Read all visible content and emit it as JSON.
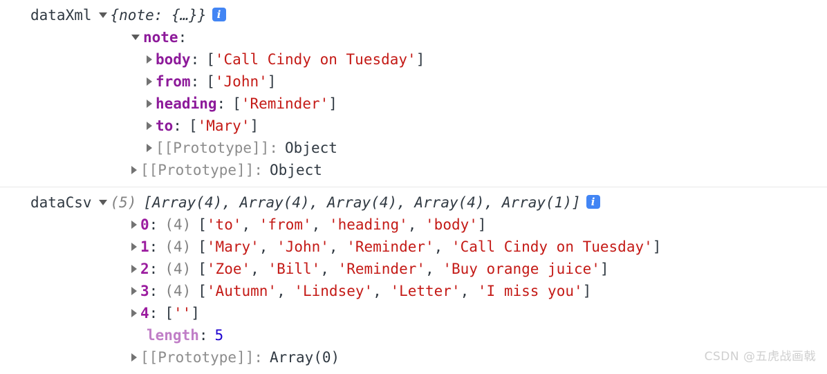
{
  "console": {
    "groups": [
      {
        "name": "dataXml",
        "preview": "{note: {…}}",
        "info_label": "i",
        "rows": [
          {
            "key": "note",
            "sep": ":",
            "value": ""
          },
          {
            "key": "body",
            "sep": ":",
            "value": "['Call Cindy on Tuesday']"
          },
          {
            "key": "from",
            "sep": ":",
            "value": "['John']"
          },
          {
            "key": "heading",
            "sep": ":",
            "value": "['Reminder']"
          },
          {
            "key": "to",
            "sep": ":",
            "value": "['Mary']"
          },
          {
            "key": "[[Prototype]]",
            "sep": ":",
            "value": "Object"
          },
          {
            "key": "[[Prototype]]",
            "sep": ":",
            "value": "Object"
          }
        ]
      },
      {
        "name": "dataCsv",
        "count": "(5)",
        "preview": "[Array(4), Array(4), Array(4), Array(4), Array(1)]",
        "info_label": "i",
        "rows": [
          {
            "key": "0",
            "sep": ":",
            "count": "(4)",
            "value": "['to', 'from', 'heading', 'body']"
          },
          {
            "key": "1",
            "sep": ":",
            "count": "(4)",
            "value": "['Mary', 'John', 'Reminder', 'Call Cindy on Tuesday']"
          },
          {
            "key": "2",
            "sep": ":",
            "count": "(4)",
            "value": "['Zoe', 'Bill', 'Reminder', 'Buy orange juice']"
          },
          {
            "key": "3",
            "sep": ":",
            "count": "(4)",
            "value": "['Autumn', 'Lindsey', 'Letter', 'I miss you']"
          },
          {
            "key": "4",
            "sep": ":",
            "count": "",
            "value": "['']"
          },
          {
            "key": "length",
            "sep": ":",
            "value": "5"
          },
          {
            "key": "[[Prototype]]",
            "sep": ":",
            "value": "Array(0)"
          }
        ]
      }
    ]
  },
  "xml": {
    "name": "dataXml",
    "preview": "{note: {…}}",
    "note_key": "note",
    "body_key": "body",
    "body_open": "[",
    "body_str": "'Call Cindy on Tuesday'",
    "body_close": "]",
    "from_key": "from",
    "from_open": "[",
    "from_str": "'John'",
    "from_close": "]",
    "heading_key": "heading",
    "heading_open": "[",
    "heading_str": "'Reminder'",
    "heading_close": "]",
    "to_key": "to",
    "to_open": "[",
    "to_str": "'Mary'",
    "to_close": "]",
    "proto_inner_key": "[[Prototype]]",
    "proto_inner_val": "Object",
    "proto_outer_key": "[[Prototype]]",
    "proto_outer_val": "Object",
    "colon": ":",
    "info": "i"
  },
  "csv": {
    "name": "dataCsv",
    "count": "(5)",
    "preview": "[Array(4), Array(4), Array(4), Array(4), Array(1)]",
    "info": "i",
    "colon": ":",
    "r0_key": "0",
    "r0_count": "(4)",
    "r0_open": "[",
    "r0_s1": "'to'",
    "r0_c1": ", ",
    "r0_s2": "'from'",
    "r0_c2": ", ",
    "r0_s3": "'heading'",
    "r0_c3": ", ",
    "r0_s4": "'body'",
    "r0_close": "]",
    "r1_key": "1",
    "r1_count": "(4)",
    "r1_open": "[",
    "r1_s1": "'Mary'",
    "r1_c1": ", ",
    "r1_s2": "'John'",
    "r1_c2": ", ",
    "r1_s3": "'Reminder'",
    "r1_c3": ", ",
    "r1_s4": "'Call Cindy on Tuesday'",
    "r1_close": "]",
    "r2_key": "2",
    "r2_count": "(4)",
    "r2_open": "[",
    "r2_s1": "'Zoe'",
    "r2_c1": ", ",
    "r2_s2": "'Bill'",
    "r2_c2": ", ",
    "r2_s3": "'Reminder'",
    "r2_c3": ", ",
    "r2_s4": "'Buy orange juice'",
    "r2_close": "]",
    "r3_key": "3",
    "r3_count": "(4)",
    "r3_open": "[",
    "r3_s1": "'Autumn'",
    "r3_c1": ", ",
    "r3_s2": "'Lindsey'",
    "r3_c2": ", ",
    "r3_s3": "'Letter'",
    "r3_c3": ", ",
    "r3_s4": "'I miss you'",
    "r3_close": "]",
    "r4_key": "4",
    "r4_open": "[",
    "r4_s1": "''",
    "r4_close": "]",
    "len_key": "length",
    "len_val": "5",
    "proto_key": "[[Prototype]]",
    "proto_val": "Array(0)"
  },
  "watermark": "CSDN @五虎战画戟",
  "colors": {
    "string": "#c41a16",
    "key": "#8d1a9a",
    "number": "#1c00cf",
    "prototype": "#8c8c8c",
    "info_badge": "#4285f4",
    "text": "#303942",
    "divider": "#e8e8e8",
    "watermark": "#cfcfcf"
  }
}
